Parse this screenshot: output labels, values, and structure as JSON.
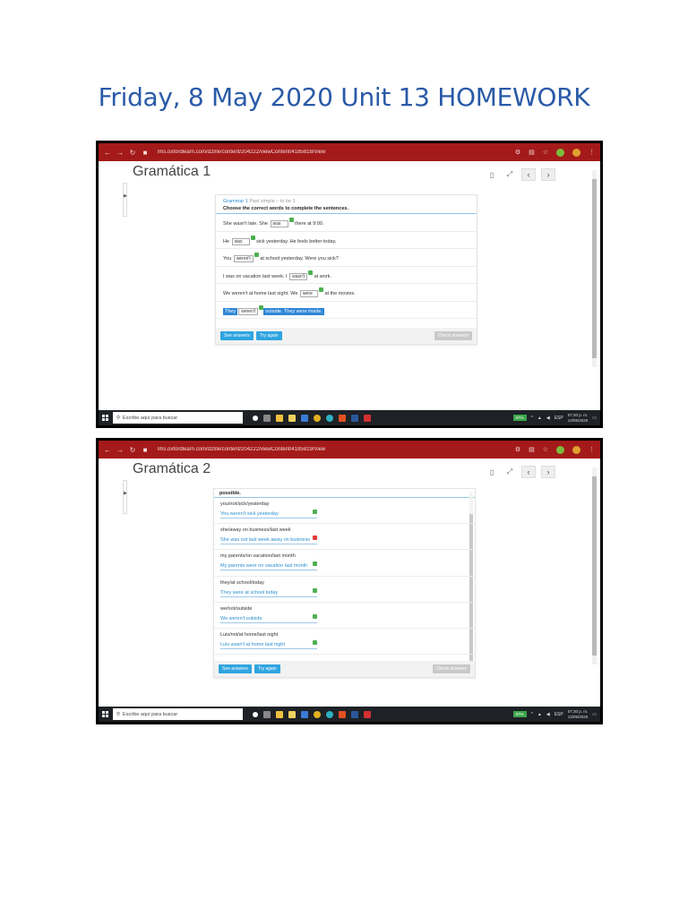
{
  "document": {
    "title": "Friday, 8 May 2020 Unit 13 HOMEWORK"
  },
  "screenshots": [
    {
      "url": "lms.oxfordlearn.com/d2l/le/content/204222/viewContent/4185818/View",
      "heading": "Gramática 1",
      "exercise": {
        "title": "Grammar 1",
        "subtitle": "Past simple – to be 1",
        "instruction": "Choose the correct words to complete the sentences.",
        "rows": [
          {
            "before": "She wasn't late. She",
            "choice": "was",
            "after": "there at 9:00."
          },
          {
            "before": "He",
            "choice": "was",
            "after": "sick yesterday. He feels better today."
          },
          {
            "before": "You",
            "choice": "weren't",
            "after": "at school yesterday. Were you sick?"
          },
          {
            "before": "I was on vacation last week. I",
            "choice": "wasn't",
            "after": "at work."
          },
          {
            "before": "We weren't at home last night. We",
            "choice": "were",
            "after": "at the movies."
          },
          {
            "before": "They",
            "choice": "weren't",
            "after": "outside. They were inside."
          }
        ],
        "buttons": {
          "see_answers": "See answers",
          "try_again": "Try again",
          "check_answers": "Check answers"
        }
      }
    },
    {
      "url": "lms.oxfordlearn.com/d2l/le/content/204222/viewContent/4185819/View",
      "heading": "Gramática 2",
      "exercise": {
        "instruction_tail": "possible.",
        "rows": [
          {
            "prompt": "you/not/sick/yesterday",
            "answer": "You weren't sick yesterday",
            "status": "correct"
          },
          {
            "prompt": "she/away on business/last week",
            "answer": "She was out last week away on business",
            "status": "incorrect"
          },
          {
            "prompt": "my parents/on vacation/last month",
            "answer": "My parents were on vacation last month",
            "status": "correct"
          },
          {
            "prompt": "they/at school/today",
            "answer": "They were at school today",
            "status": "correct"
          },
          {
            "prompt": "we/not/outside",
            "answer": "We weren't outside",
            "status": "correct"
          },
          {
            "prompt": "Luis/not/at home/last night",
            "answer": "Luis wasn't at home last night",
            "status": "correct"
          }
        ],
        "buttons": {
          "see_answers": "See answers",
          "try_again": "Try again",
          "check_answers": "Check answers"
        }
      }
    }
  ],
  "taskbar": {
    "search_placeholder": "Escribe aquí para buscar",
    "battery": "67%",
    "language": "ESP",
    "time": "07:30 p. m.",
    "date": "13/05/2020"
  },
  "colors": {
    "title": "#2a5aa8",
    "browser_bar": "#a41a1a",
    "accent": "#2fa4e0",
    "correct": "#4caf50",
    "incorrect": "#e53935"
  }
}
